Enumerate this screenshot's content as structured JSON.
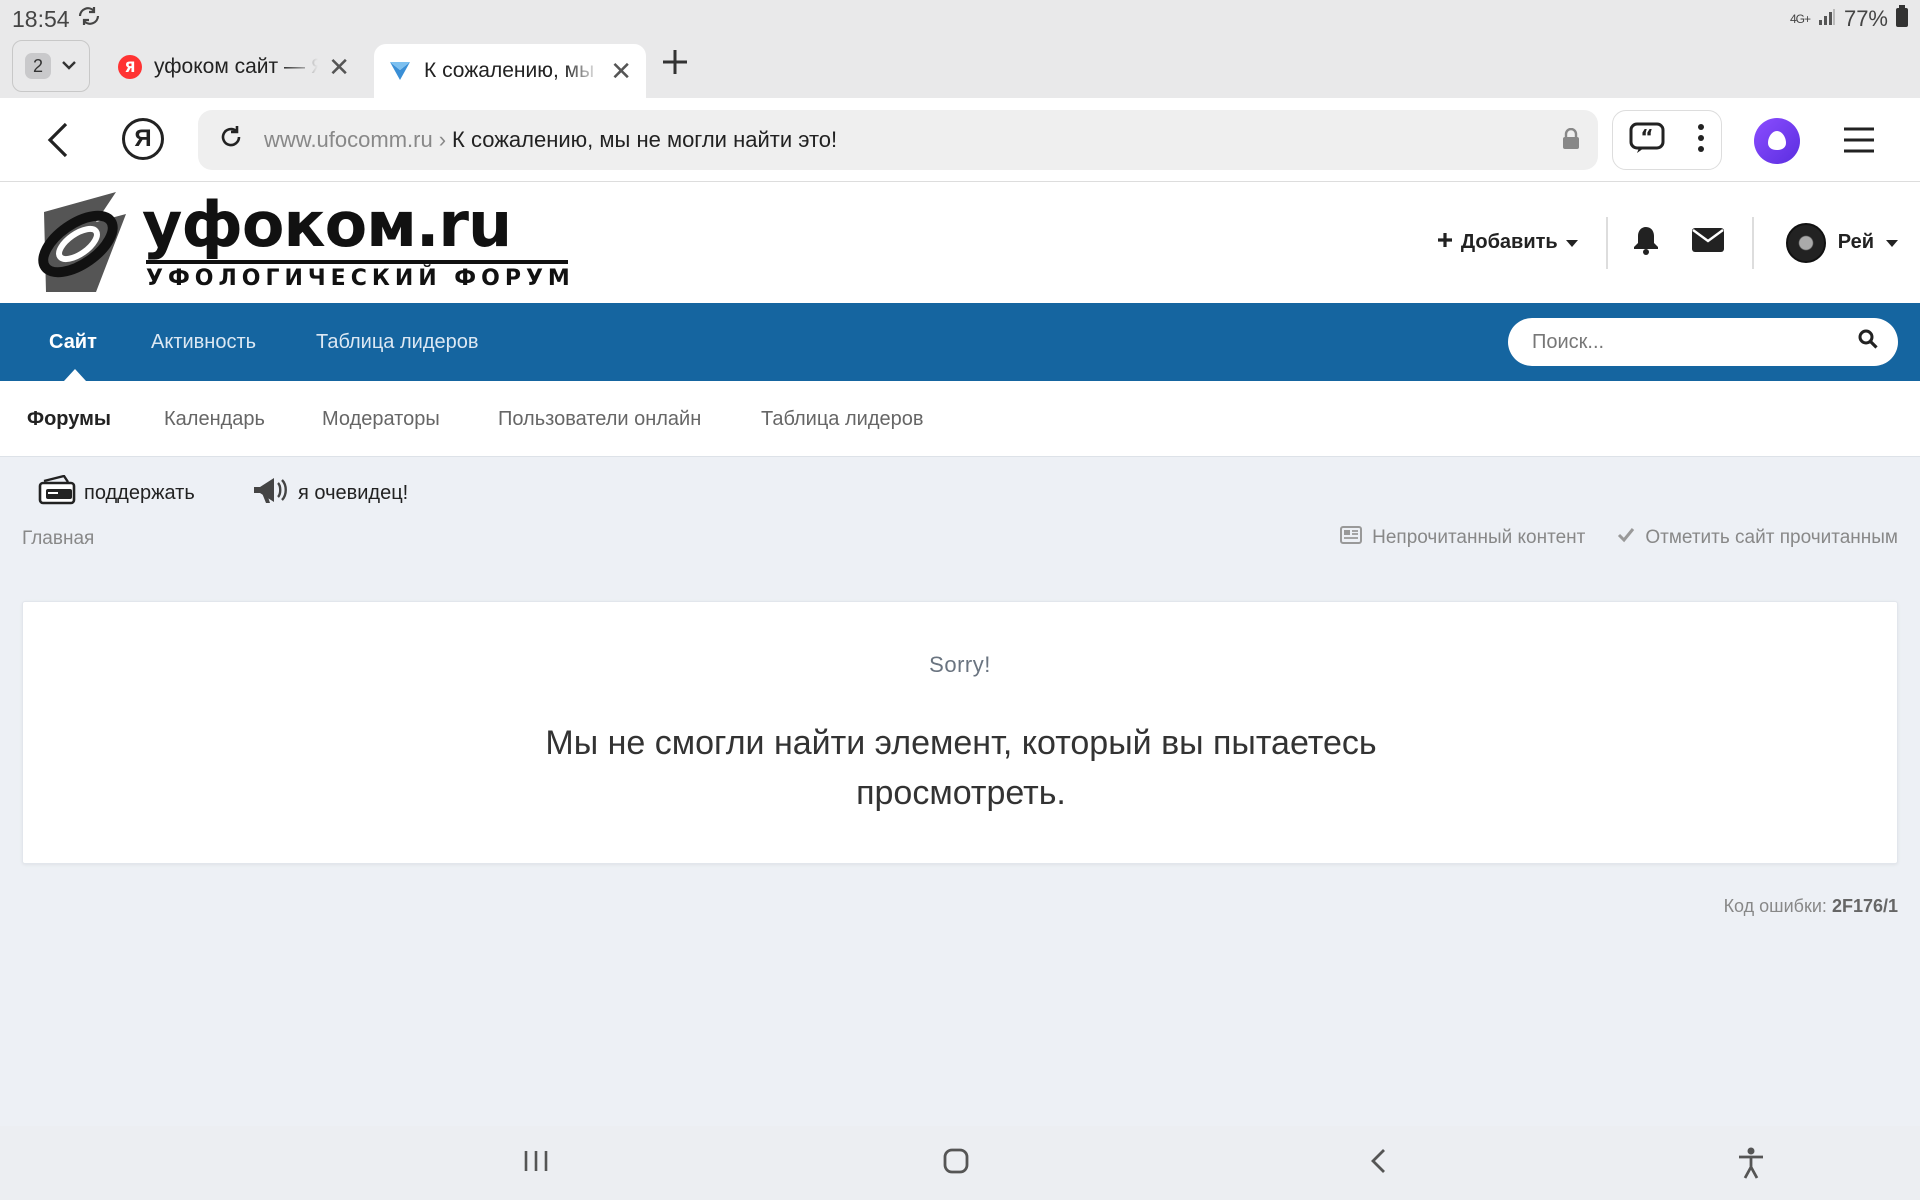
{
  "status_bar": {
    "time": "18:54",
    "battery": "77%",
    "network": "4G+"
  },
  "tabs": {
    "count": "2",
    "items": [
      {
        "label": "уфоком сайт — Я"
      },
      {
        "label": "К сожалению, мы не могли"
      }
    ]
  },
  "address_bar": {
    "domain": "www.ufocomm.ru",
    "separator": "›",
    "page_title": "К сожалению, мы не могли найти это!",
    "yandex_letter": "Я"
  },
  "site_header": {
    "logo_main": "уфоком.ru",
    "logo_sub": "УФОЛОГИЧЕСКИЙ ФОРУМ",
    "add_label": "Добавить",
    "user_name": "Рей"
  },
  "primary_nav": {
    "items": [
      {
        "label": "Сайт",
        "active": true
      },
      {
        "label": "Активность"
      },
      {
        "label": "Таблица лидеров"
      }
    ],
    "search_placeholder": "Поиск..."
  },
  "secondary_nav": {
    "items": [
      {
        "label": "Форумы",
        "active": true
      },
      {
        "label": "Календарь"
      },
      {
        "label": "Модераторы"
      },
      {
        "label": "Пользователи онлайн"
      },
      {
        "label": "Таблица лидеров"
      }
    ]
  },
  "quick_links": [
    {
      "label": "поддержать",
      "icon": "wallet-icon"
    },
    {
      "label": "я очевидец!",
      "icon": "megaphone-icon"
    }
  ],
  "breadcrumb": {
    "home": "Главная"
  },
  "breadcrumb_actions": {
    "unread": "Непрочитанный контент",
    "mark_read": "Отметить сайт прочитанным"
  },
  "error": {
    "sorry": "Sorry!",
    "message": "Мы не смогли найти элемент, который вы пытаетесь просмотреть.",
    "code_label": "Код ошибки:",
    "code": "2F176/1"
  },
  "colors": {
    "nav_blue": "#1565a0",
    "page_bg": "#edf0f5",
    "alice": "#7b3ff2"
  }
}
